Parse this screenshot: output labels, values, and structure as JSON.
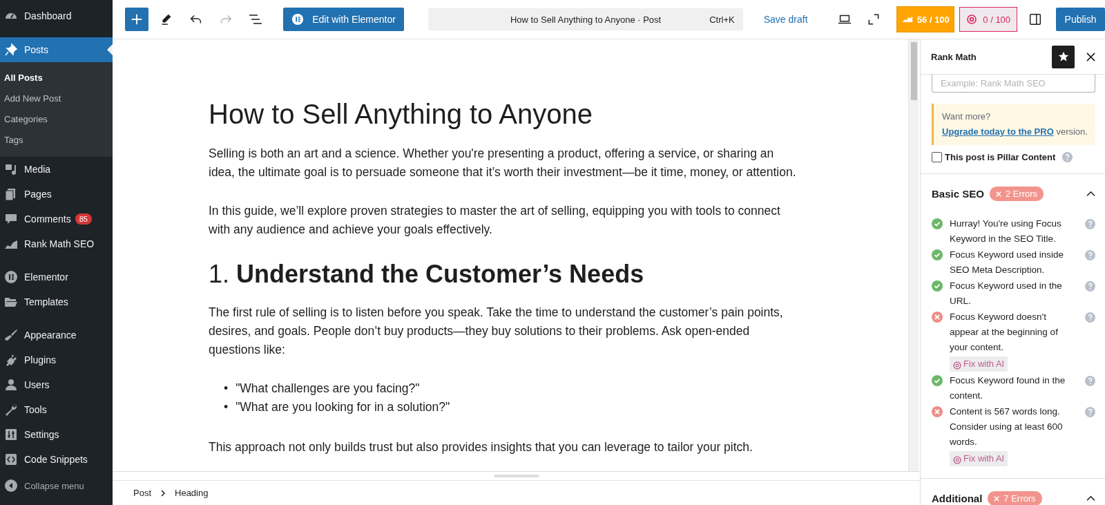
{
  "admin_menu": {
    "groups": [
      {
        "items": [
          {
            "label": "Dashboard",
            "selected": false
          }
        ]
      },
      {
        "items": [
          {
            "label": "Posts",
            "selected": true,
            "submenu": [
              {
                "label": "All Posts",
                "selected": true
              },
              {
                "label": "Add New Post",
                "selected": false
              },
              {
                "label": "Categories",
                "selected": false
              },
              {
                "label": "Tags",
                "selected": false
              }
            ]
          },
          {
            "label": "Media",
            "selected": false
          },
          {
            "label": "Pages",
            "selected": false
          },
          {
            "label": "Comments",
            "selected": false,
            "badge": "85"
          },
          {
            "label": "Rank Math SEO",
            "selected": false
          }
        ]
      },
      {
        "items": [
          {
            "label": "Elementor",
            "selected": false
          },
          {
            "label": "Templates",
            "selected": false
          }
        ]
      },
      {
        "items": [
          {
            "label": "Appearance",
            "selected": false
          },
          {
            "label": "Plugins",
            "selected": false
          },
          {
            "label": "Users",
            "selected": false
          },
          {
            "label": "Tools",
            "selected": false
          },
          {
            "label": "Settings",
            "selected": false
          },
          {
            "label": "Code Snippets",
            "selected": false
          }
        ]
      }
    ],
    "collapse": "Collapse menu"
  },
  "toolbar": {
    "undo": {
      "disabled": false
    },
    "redo": {
      "disabled": true
    },
    "edit_with_elementor": "Edit with Elementor",
    "command_bar": {
      "title": "How to Sell Anything to Anyone · Post",
      "shortcut": "Ctrl+K"
    },
    "save_draft": "Save draft",
    "seo_score": "56 / 100",
    "content_ai_score": "0 / 100",
    "publish": "Publish"
  },
  "document": {
    "title": "How to Sell Anything to Anyone",
    "blocks": [
      {
        "kind": "paragraph",
        "text": "Selling is both an art and a science. Whether you're presenting a product, offering a service, or sharing an idea, the ultimate goal is to persuade someone that it’s worth their investment—be it time, money, or attention."
      },
      {
        "kind": "paragraph",
        "text": "In this guide, we’ll explore proven strategies to master the art of selling, equipping you with tools to connect with any audience and achieve your goals effectively."
      },
      {
        "kind": "heading",
        "text": "1. **Understand the Customer’s Needs**"
      },
      {
        "kind": "paragraph",
        "text": "The first rule of selling is to listen before you speak. Take the time to understand the customer’s pain points, desires, and goals. People don’t buy products—they buy solutions to their problems. Ask open-ended questions like:"
      },
      {
        "kind": "list",
        "bullet": "•",
        "items": [
          "\"What challenges are you facing?\"",
          "\"What are you looking for in a solution?\""
        ]
      },
      {
        "kind": "paragraph",
        "text": "This approach not only builds trust but also provides insights that you can leverage to tailor your pitch."
      }
    ]
  },
  "breadcrumb": [
    "Post",
    "Heading"
  ],
  "seo_panel": {
    "title": "Rank Math",
    "focus_keyword": {
      "placeholder": "Example: Rank Math SEO"
    },
    "notice": {
      "text": "Want more? ",
      "link": "Upgrade today to the PRO",
      "after": " version."
    },
    "pillar_content": {
      "label": "This post is Pillar Content",
      "checked": false
    },
    "sections": [
      {
        "title": "Basic SEO",
        "badge": "2 Errors",
        "expanded": true,
        "checks": [
          {
            "kind": "pass",
            "text": "Hurray! You're using Focus Keyword in the SEO Title."
          },
          {
            "kind": "pass",
            "text": "Focus Keyword used inside SEO Meta Description."
          },
          {
            "kind": "pass",
            "text": "Focus Keyword used in the URL."
          },
          {
            "kind": "fail",
            "text": "Focus Keyword doesn't appear at the beginning of your content.",
            "fix": "Fix with AI"
          },
          {
            "kind": "pass",
            "text": "Focus Keyword found in the content."
          },
          {
            "kind": "fail",
            "text": "Content is 567 words long. Consider using at least 600 words.",
            "fix": "Fix with AI"
          }
        ]
      },
      {
        "title": "Additional",
        "badge": "7 Errors",
        "expanded": true
      }
    ]
  }
}
